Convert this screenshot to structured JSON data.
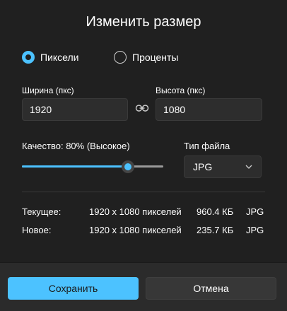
{
  "dialog": {
    "title": "Изменить размер"
  },
  "mode": {
    "options": [
      {
        "label": "Пиксели",
        "selected": true
      },
      {
        "label": "Проценты",
        "selected": false
      }
    ]
  },
  "width": {
    "label": "Ширина (пкс)",
    "value": "1920"
  },
  "height": {
    "label": "Высота (пкс)",
    "value": "1080"
  },
  "lock_icon": "link-icon",
  "quality": {
    "label": "Качество: 80% (Высокое)",
    "percent": 80
  },
  "file_type": {
    "label": "Тип файла",
    "selected": "JPG"
  },
  "current": {
    "label": "Текущее:",
    "dimensions": "1920 x 1080 пикселей",
    "size": "960.4 КБ",
    "format": "JPG"
  },
  "new": {
    "label": "Новое:",
    "dimensions": "1920 x 1080 пикселей",
    "size": "235.7 КБ",
    "format": "JPG"
  },
  "buttons": {
    "save": "Сохранить",
    "cancel": "Отмена"
  },
  "colors": {
    "accent": "#4cc2ff",
    "background": "#202020",
    "footer": "#2b2b2b"
  }
}
